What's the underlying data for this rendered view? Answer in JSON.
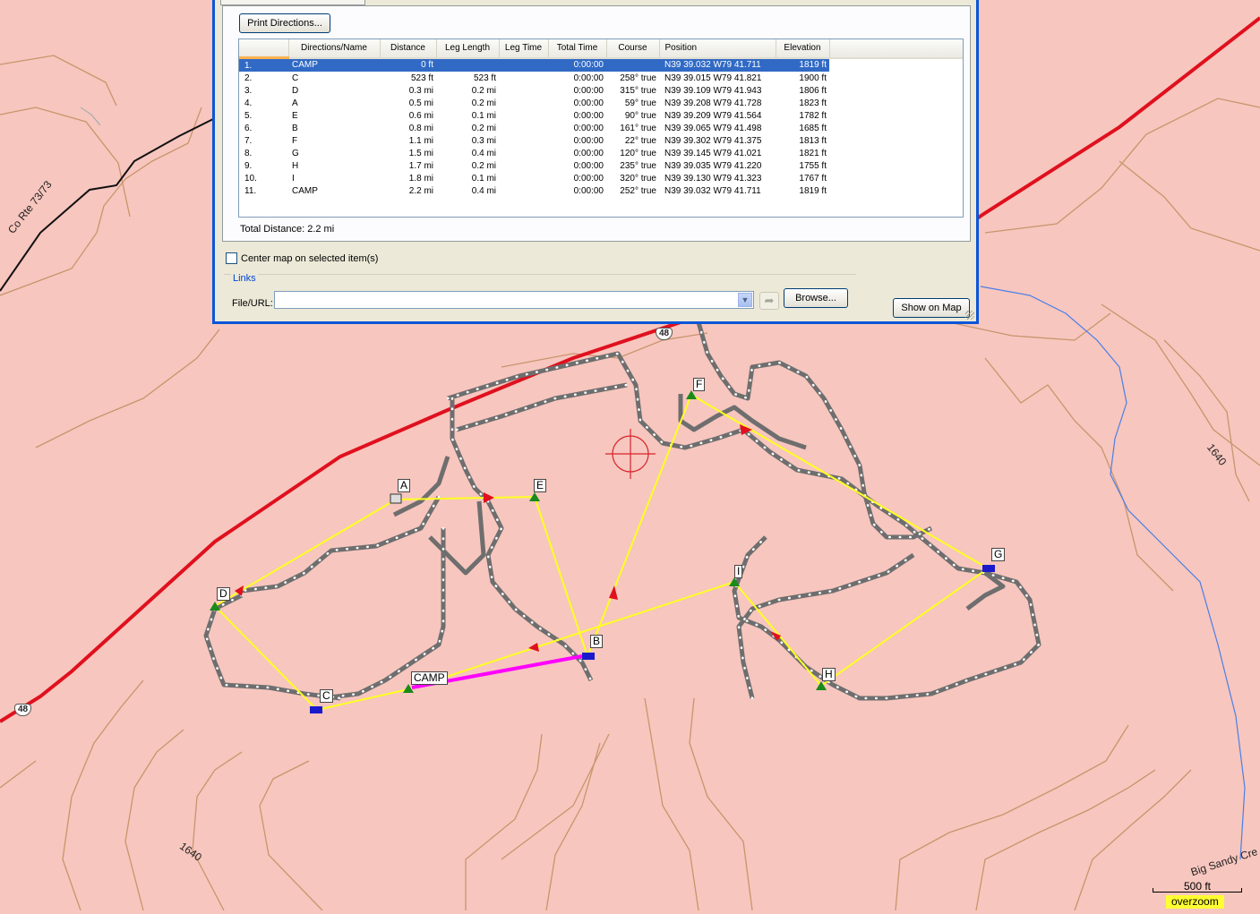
{
  "map": {
    "road_label": "Co Rte 73/73",
    "highway_shield": "48",
    "contour_label": "1640",
    "creek_label": "Big Sandy Cre",
    "scale_label": "500 ft",
    "overzoom_label": "overzoom",
    "crosshair_icon": "crosshair-icon",
    "waypoints": [
      "A",
      "B",
      "C",
      "D",
      "E",
      "F",
      "G",
      "H",
      "I",
      "CAMP"
    ],
    "colors": {
      "background": "#f7c6be",
      "contour": "#c8956c",
      "highway": "#e0101e",
      "route": "#ffff22",
      "trail": "#6e6e6e",
      "creek": "#4a7fe6",
      "highlight": "#ff00ff"
    }
  },
  "dialog": {
    "print_button": "Print Directions...",
    "columns": [
      "Directions/Name",
      "Distance",
      "Leg Length",
      "Leg Time",
      "Total Time",
      "Course",
      "Position",
      "Elevation"
    ],
    "rows": [
      {
        "num": "1.",
        "name": "CAMP",
        "distance": "0 ft",
        "leg_length": "",
        "leg_time": "",
        "total_time": "0:00:00",
        "course": "",
        "position": "N39 39.032 W79 41.711",
        "elevation": "1819 ft"
      },
      {
        "num": "2.",
        "name": "C",
        "distance": "523 ft",
        "leg_length": "523 ft",
        "leg_time": "",
        "total_time": "0:00:00",
        "course": "258° true",
        "position": "N39 39.015 W79 41.821",
        "elevation": "1900 ft"
      },
      {
        "num": "3.",
        "name": "D",
        "distance": "0.3 mi",
        "leg_length": "0.2 mi",
        "leg_time": "",
        "total_time": "0:00:00",
        "course": "315° true",
        "position": "N39 39.109 W79 41.943",
        "elevation": "1806 ft"
      },
      {
        "num": "4.",
        "name": "A",
        "distance": "0.5 mi",
        "leg_length": "0.2 mi",
        "leg_time": "",
        "total_time": "0:00:00",
        "course": "59° true",
        "position": "N39 39.208 W79 41.728",
        "elevation": "1823 ft"
      },
      {
        "num": "5.",
        "name": "E",
        "distance": "0.6 mi",
        "leg_length": "0.1 mi",
        "leg_time": "",
        "total_time": "0:00:00",
        "course": "90° true",
        "position": "N39 39.209 W79 41.564",
        "elevation": "1782 ft"
      },
      {
        "num": "6.",
        "name": "B",
        "distance": "0.8 mi",
        "leg_length": "0.2 mi",
        "leg_time": "",
        "total_time": "0:00:00",
        "course": "161° true",
        "position": "N39 39.065 W79 41.498",
        "elevation": "1685 ft"
      },
      {
        "num": "7.",
        "name": "F",
        "distance": "1.1 mi",
        "leg_length": "0.3 mi",
        "leg_time": "",
        "total_time": "0:00:00",
        "course": "22° true",
        "position": "N39 39.302 W79 41.375",
        "elevation": "1813 ft"
      },
      {
        "num": "8.",
        "name": "G",
        "distance": "1.5 mi",
        "leg_length": "0.4 mi",
        "leg_time": "",
        "total_time": "0:00:00",
        "course": "120° true",
        "position": "N39 39.145 W79 41.021",
        "elevation": "1821 ft"
      },
      {
        "num": "9.",
        "name": "H",
        "distance": "1.7 mi",
        "leg_length": "0.2 mi",
        "leg_time": "",
        "total_time": "0:00:00",
        "course": "235° true",
        "position": "N39 39.035 W79 41.220",
        "elevation": "1755 ft"
      },
      {
        "num": "10.",
        "name": "I",
        "distance": "1.8 mi",
        "leg_length": "0.1 mi",
        "leg_time": "",
        "total_time": "0:00:00",
        "course": "320° true",
        "position": "N39 39.130 W79 41.323",
        "elevation": "1767 ft"
      },
      {
        "num": "11.",
        "name": "CAMP",
        "distance": "2.2 mi",
        "leg_length": "0.4 mi",
        "leg_time": "",
        "total_time": "0:00:00",
        "course": "252° true",
        "position": "N39 39.032 W79 41.711",
        "elevation": "1819 ft"
      }
    ],
    "selected_row": 0,
    "total_distance": "Total Distance: 2.2 mi",
    "center_map_label": "Center map on selected item(s)",
    "center_map_checked": false,
    "links_legend": "Links",
    "file_url_label": "File/URL:",
    "file_url_value": "",
    "browse_button": "Browse...",
    "show_on_map_button": "Show on Map"
  }
}
